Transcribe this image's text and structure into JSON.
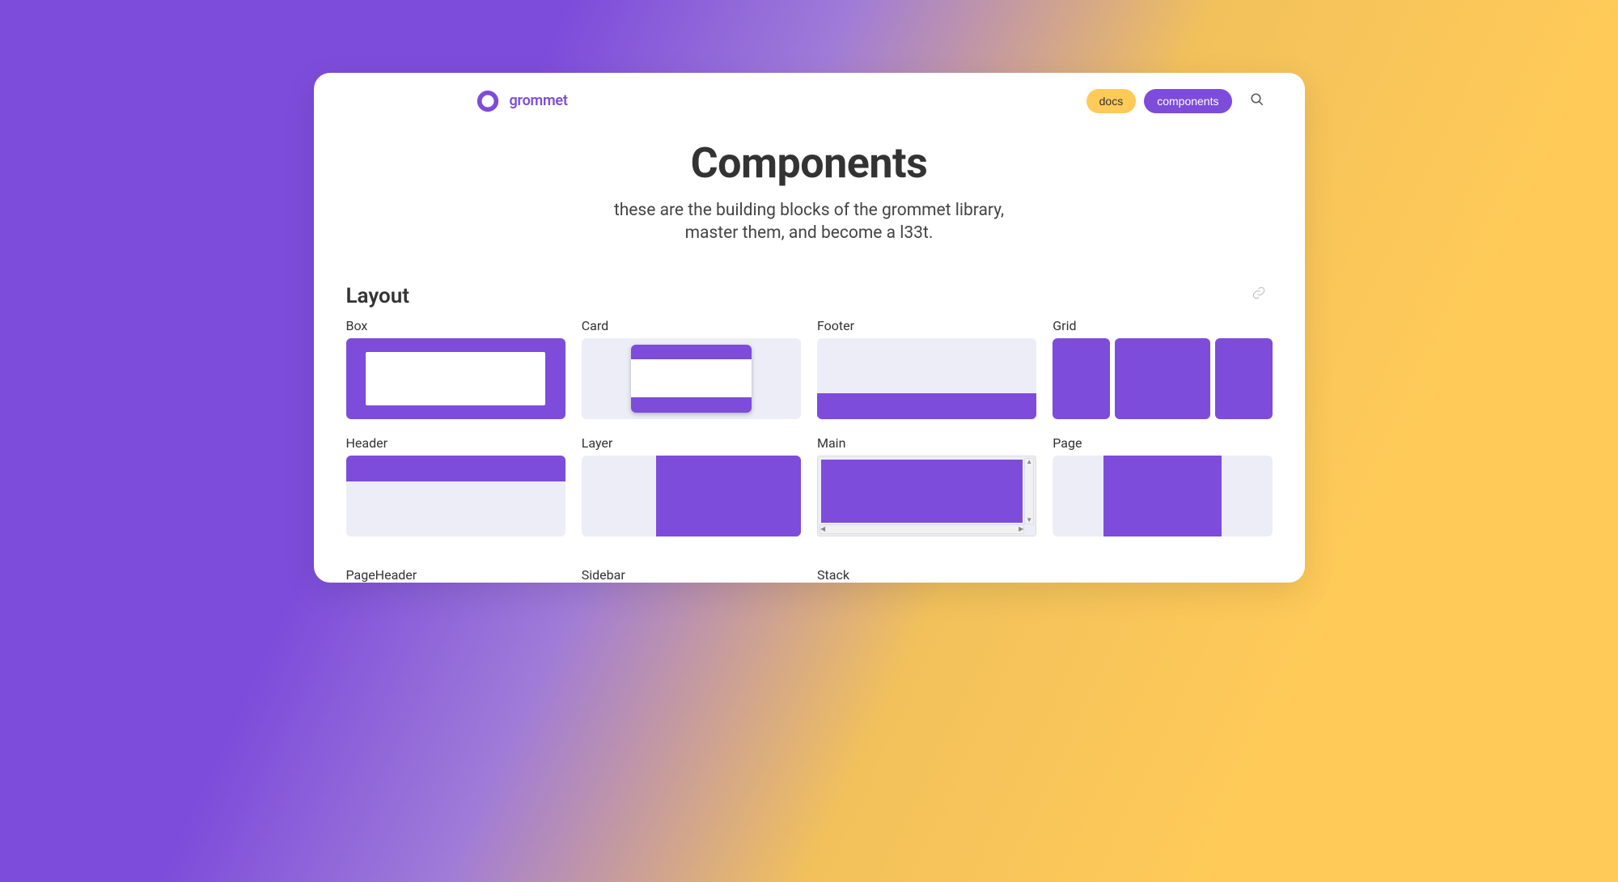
{
  "brand": {
    "name": "grommet"
  },
  "nav": {
    "docs_label": "docs",
    "components_label": "components"
  },
  "hero": {
    "title": "Components",
    "subtitle1": "these are the building blocks of the grommet library,",
    "subtitle2": "master them, and become a l33t."
  },
  "section": {
    "title": "Layout"
  },
  "items": {
    "box": "Box",
    "card": "Card",
    "footer": "Footer",
    "grid": "Grid",
    "header": "Header",
    "layer": "Layer",
    "main": "Main",
    "page": "Page",
    "pageheader": "PageHeader",
    "sidebar": "Sidebar",
    "stack": "Stack"
  }
}
